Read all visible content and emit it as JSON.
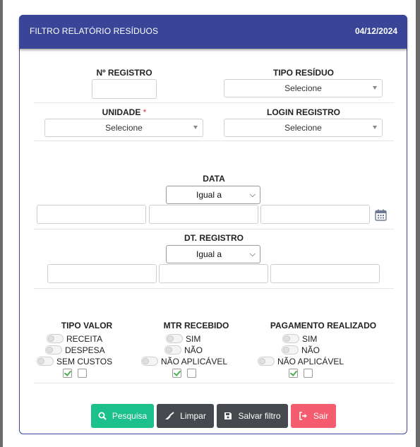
{
  "header": {
    "title": "FILTRO RELATÓRIO RESÍDUOS",
    "date": "04/12/2024"
  },
  "fields": {
    "n_registro": {
      "label": "Nº REGISTRO",
      "value": ""
    },
    "tipo_residuo": {
      "label": "TIPO RESÍDUO",
      "selected": "Selecione"
    },
    "unidade": {
      "label": "UNIDADE",
      "required_mark": "*",
      "selected": "Selecione"
    },
    "login_registro": {
      "label": "LOGIN REGISTRO",
      "selected": "Selecione"
    },
    "data": {
      "label": "DATA",
      "operator": "Igual a"
    },
    "dt_registro": {
      "label": "DT. REGISTRO",
      "operator": "Igual a"
    }
  },
  "groups": {
    "tipo_valor": {
      "label": "TIPO VALOR",
      "options": [
        "RECEITA",
        "DESPESA",
        "SEM CUSTOS"
      ]
    },
    "mtr_recebido": {
      "label": "MTR RECEBIDO",
      "options": [
        "SIM",
        "NÃO",
        "NÃO APLICÁVEL"
      ]
    },
    "pagamento_realizado": {
      "label": "PAGAMENTO REALIZADO",
      "options": [
        "SIM",
        "NÃO",
        "NÃO APLICÁVEL"
      ]
    }
  },
  "buttons": {
    "pesquisa": {
      "label": "Pesquisa",
      "color": "#1cc08b"
    },
    "limpar": {
      "label": "Limpar",
      "color": "#45494e"
    },
    "salvar": {
      "label": "Salvar filtro",
      "color": "#45494e"
    },
    "sair": {
      "label": "Sair",
      "color": "#f45d6f"
    }
  },
  "colors": {
    "header": "#3a4597",
    "card_border": "#3a4597",
    "required": "#d9303a",
    "check": "#4caf50"
  },
  "icons": {
    "calendar": "calendar-icon",
    "search": "search-icon",
    "broom": "broom-icon",
    "save": "save-icon",
    "exit": "sign-out-icon"
  }
}
